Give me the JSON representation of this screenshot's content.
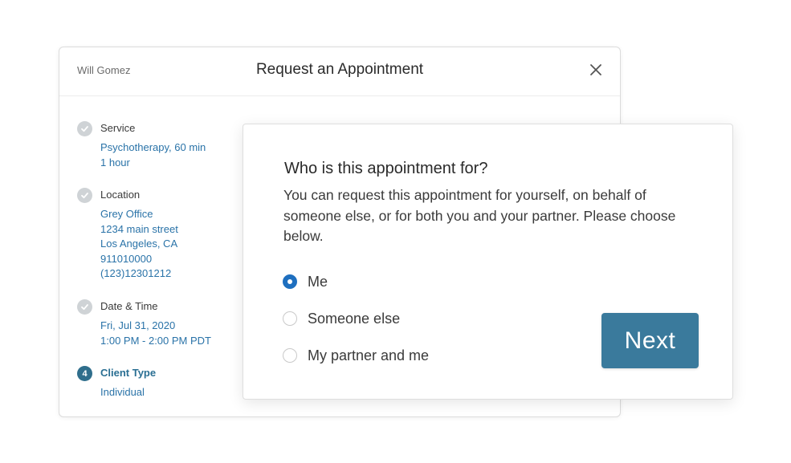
{
  "dialog": {
    "provider_name": "Will Gomez",
    "title": "Request an Appointment"
  },
  "steps": [
    {
      "label": "Service",
      "status": "complete",
      "details": [
        "Psychotherapy, 60 min",
        "1 hour"
      ]
    },
    {
      "label": "Location",
      "status": "complete",
      "details": [
        "Grey Office",
        "1234 main street",
        "Los Angeles, CA",
        "911010000",
        "(123)12301212"
      ]
    },
    {
      "label": "Date & Time",
      "status": "complete",
      "details": [
        "Fri, Jul 31, 2020",
        "1:00 PM - 2:00 PM PDT"
      ]
    },
    {
      "label": "Client Type",
      "status": "active",
      "number": "4",
      "details": [
        "Individual"
      ]
    }
  ],
  "card": {
    "question": "Who is this appointment for?",
    "description": "You can request this appointment for yourself, on behalf of someone else, or for both you and your partner. Please choose below.",
    "options": [
      {
        "label": "Me",
        "selected": true
      },
      {
        "label": "Someone else",
        "selected": false
      },
      {
        "label": "My partner and me",
        "selected": false
      }
    ],
    "next_label": "Next"
  },
  "colors": {
    "accent": "#3a7a9c",
    "link": "#2a73a8",
    "radio_selected": "#1e6fbf",
    "step_complete": "#cfd3d6",
    "step_active": "#2f6e8c"
  },
  "icons": {
    "close": "close-icon",
    "step_complete": "checkmark-icon"
  }
}
